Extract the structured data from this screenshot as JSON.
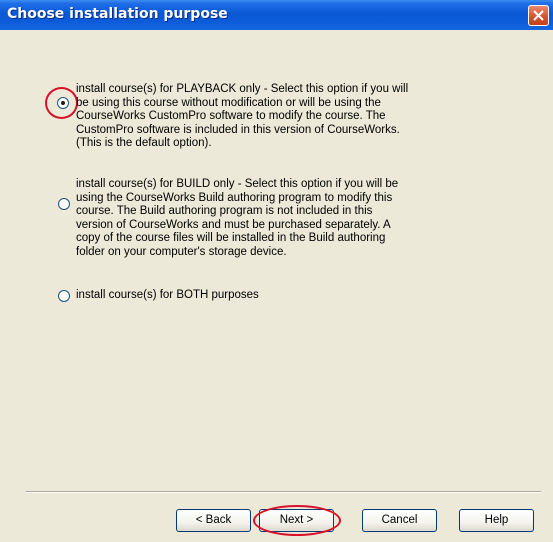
{
  "window": {
    "title": "Choose installation purpose"
  },
  "options": {
    "playback": {
      "lines": [
        "install course(s) for PLAYBACK only - Select this option if you will",
        "be using this course without modification or will be using the",
        "CourseWorks CustomPro software to modify the course.  The",
        "CustomPro software is included in this version of CourseWorks.",
        "(This is the default option)."
      ],
      "selected": true
    },
    "build": {
      "lines": [
        "install course(s) for BUILD only  - Select this option if you will be",
        "using the CourseWorks Build authoring program to modify this",
        "course. The Build authoring program is not included in this",
        "version of CourseWorks and must be purchased separately.  A",
        "copy of the course files will be installed in the Build authoring",
        "folder on your computer's storage device."
      ],
      "selected": false
    },
    "both": {
      "label": "install course(s) for BOTH purposes",
      "selected": false
    }
  },
  "buttons": {
    "back": "< Back",
    "next": "Next >",
    "cancel": "Cancel",
    "help": "Help"
  },
  "colors": {
    "titlebar": "#0a58d6",
    "dialog_bg": "#ece9d8",
    "highlight_circle": "#d8102a"
  }
}
